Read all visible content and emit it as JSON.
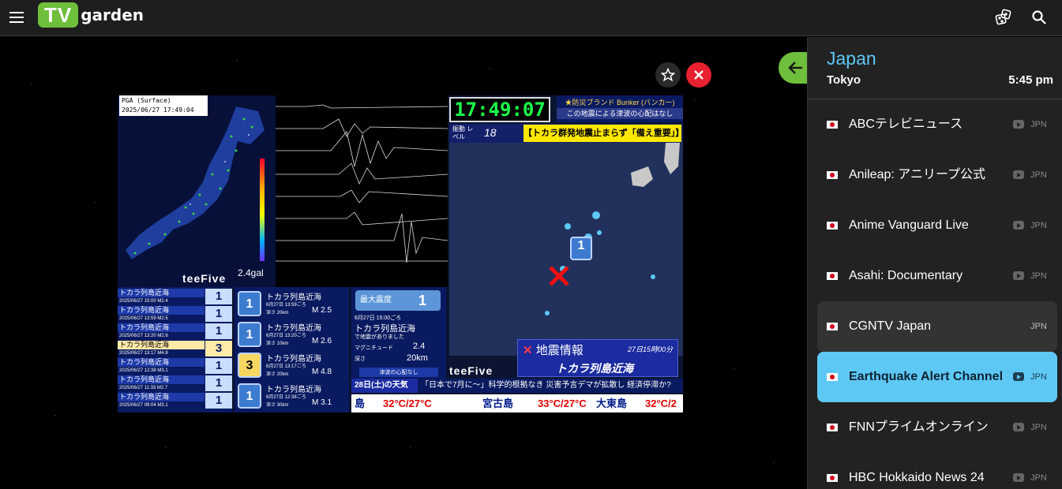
{
  "app": {
    "logo_tv": "TV",
    "logo_garden": "garden"
  },
  "colors": {
    "accent_green": "#6fbf3c",
    "accent_blue": "#5ec8f5",
    "close_red": "#e8202f"
  },
  "icons": {
    "menu": "hamburger-icon",
    "random": "dice-icon",
    "search": "search-icon",
    "favorite": "star-icon",
    "close": "close-icon",
    "collapse": "arrow-left-icon"
  },
  "video": {
    "pga_title": "PGA (Surface)",
    "pga_time": "2025/06/27 17:49:04",
    "gal": "2.4gal",
    "watermark": "teeFive",
    "clock": "17:49:07",
    "bunker_line1": "★防災ブランド Bunker (バンカー)",
    "bunker_line2": "この地震による津波の心配はなし",
    "level_label": "振動 レベル",
    "level_value": "18",
    "headline": "【トカラ群発地震止まらず「備え重要」】",
    "quake_list": [
      {
        "name": "トカラ列島近海",
        "date": "2025/06/27 15:00 M2.4",
        "shindo": "1"
      },
      {
        "name": "トカラ列島近海",
        "date": "2025/06/27 13:59 M2.5",
        "shindo": "1"
      },
      {
        "name": "トカラ列島近海",
        "date": "2025/06/27 13:20 M2.6",
        "shindo": "1"
      },
      {
        "name": "トカラ列島近海",
        "date": "2025/06/27 13:17 M4.8",
        "shindo": "3"
      },
      {
        "name": "トカラ列島近海",
        "date": "2025/06/27 12:38 M3.1",
        "shindo": "1"
      },
      {
        "name": "トカラ列島近海",
        "date": "2025/06/27 11:33 M2.7",
        "shindo": "1"
      },
      {
        "name": "トカラ列島近海",
        "date": "2025/06/27 09:04 M3.1",
        "shindo": "1"
      }
    ],
    "quake_detail": [
      {
        "shindo": "1",
        "name": "トカラ列島近海",
        "time": "6月27日 13:59ごろ",
        "depth": "深さ 20km",
        "mag": "M 2.5"
      },
      {
        "shindo": "1",
        "name": "トカラ列島近海",
        "time": "6月27日 13:20ごろ",
        "depth": "深さ 10km",
        "mag": "M 2.6"
      },
      {
        "shindo": "3",
        "name": "トカラ列島近海",
        "time": "6月27日 13:17ごろ",
        "depth": "深さ 20km",
        "mag": "M 4.8"
      },
      {
        "shindo": "1",
        "name": "トカラ列島近海",
        "time": "6月27日 12:38ごろ",
        "depth": "深さ 30km",
        "mag": "M 3.1"
      }
    ],
    "info": {
      "max_label": "最大震度",
      "max_value": "1",
      "time": "6月27日 15:00ごろ",
      "name": "トカラ列島近海",
      "note": "で地震がありました",
      "mag_label": "マグニチュード",
      "mag_value": "2.4",
      "depth_label": "深さ",
      "depth_value": "20km",
      "tsunami": "津波の心配なし"
    },
    "quake_box": {
      "title": "地震情報",
      "time": "27日15時00分",
      "area": "トカラ列島近海"
    },
    "weather_day": "28日(土)の天気",
    "ticker": "「日本で7月に〜」科学的根拠なき 災害予言デマが拡散し 経済停滞か?",
    "temps": [
      {
        "place": "島",
        "temp": "32°C/27°C"
      },
      {
        "place": "宮古島",
        "temp": "33°C/27°C"
      },
      {
        "place": "大東島",
        "temp": "32°C/2"
      }
    ],
    "map_marker": "1"
  },
  "sidebar": {
    "country": "Japan",
    "city": "Tokyo",
    "time": "5:45 pm",
    "channels": [
      {
        "name": "ABCテレビニュース",
        "code": "JPN",
        "state": "normal"
      },
      {
        "name": "Anileap: アニリープ公式",
        "code": "JPN",
        "state": "normal"
      },
      {
        "name": "Anime Vanguard Live",
        "code": "JPN",
        "state": "normal"
      },
      {
        "name": "Asahi: Documentary",
        "code": "JPN",
        "state": "normal"
      },
      {
        "name": "CGNTV Japan",
        "code": "JPN",
        "state": "hover"
      },
      {
        "name": "Earthquake Alert Channel",
        "code": "JPN",
        "state": "active"
      },
      {
        "name": "FNNプライムオンライン",
        "code": "JPN",
        "state": "normal"
      },
      {
        "name": "HBC Hokkaido News 24",
        "code": "JPN",
        "state": "normal"
      }
    ]
  }
}
